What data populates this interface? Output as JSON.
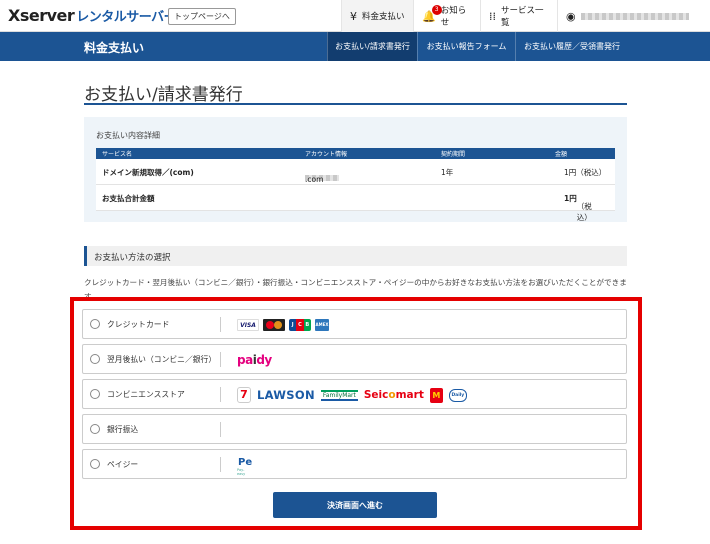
{
  "topbar": {
    "logo_main": "Xserver",
    "logo_sub": "レンタルサーバー",
    "toppage_label": "トップページへ",
    "nav": [
      {
        "label": "料金支払い",
        "icon": "yen-icon"
      },
      {
        "label": "お知らせ",
        "icon": "bell-icon",
        "badge": "3"
      },
      {
        "label": "サービス一覧",
        "icon": "grid-icon"
      }
    ]
  },
  "header": {
    "title": "料金支払い",
    "tabs": [
      "お支払い/請求書発行",
      "お支払い報告フォーム",
      "お支払い履歴／受領書発行"
    ]
  },
  "page": {
    "title": "お支払い/請求書発行"
  },
  "summary": {
    "label": "お支払い内容詳細",
    "columns": [
      "サービス名",
      "アカウント情報",
      "契約期間",
      "金額"
    ],
    "row": {
      "service": "ドメイン新規取得／(com)",
      "account": ".com",
      "period": "1年",
      "amount": "1円（税込）"
    },
    "total": {
      "label": "お支払合計金額",
      "amount": "1円",
      "tax": "（税込）"
    }
  },
  "section": {
    "title": "お支払い方法の選択",
    "description": "クレジットカード・翌月後払い（コンビニ／銀行）・銀行振込・コンビニエンスストア・ペイジーの中からお好きなお支払い方法をお選びいただくことができます。"
  },
  "methods": [
    {
      "label": "クレジットカード"
    },
    {
      "label": "翌月後払い（コンビニ／銀行）"
    },
    {
      "label": "コンビニエンスストア"
    },
    {
      "label": "銀行振込"
    },
    {
      "label": "ペイジー"
    }
  ],
  "logos": {
    "visa": "VISA",
    "jcb": [
      "J",
      "C",
      "B"
    ],
    "amex": "AMEX",
    "paidy_1": "pa",
    "paidy_2": "i",
    "paidy_3": "dy",
    "seven": "7",
    "lawson": "LAWSON",
    "familymart": "FamilyMart",
    "seico_1": "Seic",
    "seico_2": "o",
    "seico_3": "mart",
    "ministop": "M",
    "dailyyamazaki": "Daily",
    "payeasy_mark": "Pe",
    "payeasy_text": "Pay-easy"
  },
  "submit_label": "決済画面へ進む",
  "colors": {
    "brand": "#1c5493",
    "highlight": "#e50000"
  }
}
